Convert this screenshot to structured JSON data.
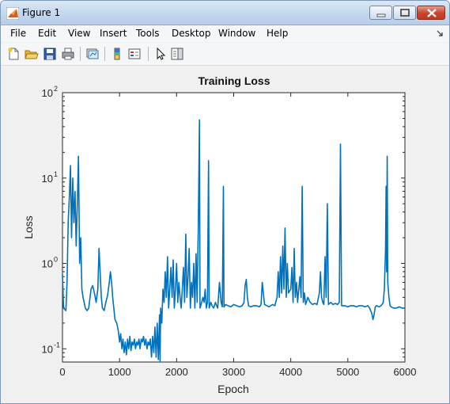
{
  "window": {
    "title": "Figure 1"
  },
  "menu": {
    "items": [
      "File",
      "Edit",
      "View",
      "Insert",
      "Tools",
      "Desktop",
      "Window",
      "Help"
    ]
  },
  "toolbar": {
    "icons": [
      "new-figure-icon",
      "open-file-icon",
      "save-icon",
      "print-icon",
      "link-plot-icon",
      "colorbar-icon",
      "legend-icon",
      "pointer-icon",
      "property-editor-icon"
    ]
  },
  "chart_data": {
    "type": "line",
    "title": "Training Loss",
    "xlabel": "Epoch",
    "ylabel": "Loss",
    "xlim": [
      0,
      6000
    ],
    "ylim": [
      0.07,
      100
    ],
    "yscale": "log",
    "x_ticks": [
      "0",
      "1000",
      "2000",
      "3000",
      "4000",
      "5000",
      "6000"
    ],
    "y_ticks": [
      "10",
      "10",
      "10",
      "10"
    ],
    "y_tick_exponents": [
      "-1",
      "0",
      "1",
      "2"
    ],
    "grid": false,
    "series": [
      {
        "color": "#0072bd",
        "points": [
          [
            0,
            0.75
          ],
          [
            20,
            0.3
          ],
          [
            60,
            0.28
          ],
          [
            80,
            0.6
          ],
          [
            100,
            3
          ],
          [
            120,
            6
          ],
          [
            140,
            14
          ],
          [
            160,
            2
          ],
          [
            180,
            10
          ],
          [
            200,
            3
          ],
          [
            220,
            7
          ],
          [
            240,
            1.6
          ],
          [
            260,
            5
          ],
          [
            280,
            18
          ],
          [
            300,
            1
          ],
          [
            320,
            2
          ],
          [
            340,
            0.5
          ],
          [
            360,
            0.4
          ],
          [
            380,
            0.35
          ],
          [
            400,
            0.3
          ],
          [
            430,
            0.28
          ],
          [
            460,
            0.3
          ],
          [
            500,
            0.5
          ],
          [
            530,
            0.55
          ],
          [
            560,
            0.45
          ],
          [
            590,
            0.35
          ],
          [
            620,
            0.5
          ],
          [
            640,
            1.5
          ],
          [
            660,
            0.8
          ],
          [
            680,
            0.4
          ],
          [
            700,
            0.3
          ],
          [
            730,
            0.28
          ],
          [
            760,
            0.35
          ],
          [
            790,
            0.42
          ],
          [
            820,
            0.6
          ],
          [
            840,
            0.8
          ],
          [
            860,
            0.6
          ],
          [
            880,
            0.4
          ],
          [
            900,
            0.3
          ],
          [
            920,
            0.22
          ],
          [
            950,
            0.2
          ],
          [
            980,
            0.16
          ],
          [
            1000,
            0.12
          ],
          [
            1020,
            0.15
          ],
          [
            1040,
            0.1
          ],
          [
            1060,
            0.13
          ],
          [
            1080,
            0.09
          ],
          [
            1100,
            0.12
          ],
          [
            1120,
            0.085
          ],
          [
            1140,
            0.13
          ],
          [
            1160,
            0.1
          ],
          [
            1180,
            0.14
          ],
          [
            1200,
            0.095
          ],
          [
            1220,
            0.12
          ],
          [
            1240,
            0.11
          ],
          [
            1260,
            0.13
          ],
          [
            1280,
            0.1
          ],
          [
            1300,
            0.12
          ],
          [
            1320,
            0.11
          ],
          [
            1340,
            0.13
          ],
          [
            1360,
            0.1
          ],
          [
            1380,
            0.13
          ],
          [
            1400,
            0.12
          ],
          [
            1420,
            0.14
          ],
          [
            1440,
            0.11
          ],
          [
            1460,
            0.13
          ],
          [
            1480,
            0.1
          ],
          [
            1500,
            0.12
          ],
          [
            1520,
            0.11
          ],
          [
            1540,
            0.13
          ],
          [
            1560,
            0.08
          ],
          [
            1580,
            0.14
          ],
          [
            1600,
            0.09
          ],
          [
            1620,
            0.18
          ],
          [
            1640,
            0.08
          ],
          [
            1660,
            0.2
          ],
          [
            1680,
            0.075
          ],
          [
            1700,
            0.25
          ],
          [
            1710,
            0.07
          ],
          [
            1720,
            0.3
          ],
          [
            1740,
            0.2
          ],
          [
            1760,
            0.5
          ],
          [
            1780,
            0.35
          ],
          [
            1800,
            0.8
          ],
          [
            1820,
            0.4
          ],
          [
            1840,
            1.2
          ],
          [
            1860,
            0.3
          ],
          [
            1880,
            0.5
          ],
          [
            1900,
            0.9
          ],
          [
            1920,
            0.4
          ],
          [
            1940,
            1.1
          ],
          [
            1960,
            0.3
          ],
          [
            1980,
            0.5
          ],
          [
            2000,
            1
          ],
          [
            2020,
            0.35
          ],
          [
            2040,
            0.6
          ],
          [
            2060,
            0.4
          ],
          [
            2080,
            0.3
          ],
          [
            2100,
            0.5
          ],
          [
            2120,
            0.9
          ],
          [
            2140,
            0.35
          ],
          [
            2160,
            2.2
          ],
          [
            2180,
            0.4
          ],
          [
            2200,
            0.7
          ],
          [
            2220,
            1.5
          ],
          [
            2240,
            0.3
          ],
          [
            2260,
            0.6
          ],
          [
            2280,
            0.4
          ],
          [
            2300,
            1
          ],
          [
            2320,
            0.3
          ],
          [
            2340,
            1.3
          ],
          [
            2360,
            0.35
          ],
          [
            2380,
            3
          ],
          [
            2400,
            48
          ],
          [
            2410,
            0.3
          ],
          [
            2440,
            0.35
          ],
          [
            2460,
            0.4
          ],
          [
            2480,
            0.35
          ],
          [
            2500,
            0.5
          ],
          [
            2520,
            0.3
          ],
          [
            2540,
            0.35
          ],
          [
            2560,
            16
          ],
          [
            2570,
            0.3
          ],
          [
            2600,
            0.35
          ],
          [
            2620,
            0.32
          ],
          [
            2650,
            0.3
          ],
          [
            2680,
            0.35
          ],
          [
            2700,
            0.32
          ],
          [
            2720,
            0.3
          ],
          [
            2750,
            0.6
          ],
          [
            2780,
            0.35
          ],
          [
            2800,
            0.31
          ],
          [
            2820,
            8
          ],
          [
            2830,
            0.31
          ],
          [
            2860,
            0.33
          ],
          [
            2900,
            0.32
          ],
          [
            2950,
            0.31
          ],
          [
            3000,
            0.33
          ],
          [
            3050,
            0.32
          ],
          [
            3100,
            0.31
          ],
          [
            3150,
            0.32
          ],
          [
            3180,
            0.35
          ],
          [
            3200,
            0.55
          ],
          [
            3220,
            0.65
          ],
          [
            3240,
            0.4
          ],
          [
            3260,
            0.32
          ],
          [
            3300,
            0.31
          ],
          [
            3350,
            0.32
          ],
          [
            3400,
            0.32
          ],
          [
            3450,
            0.31
          ],
          [
            3480,
            0.33
          ],
          [
            3500,
            0.6
          ],
          [
            3520,
            0.45
          ],
          [
            3540,
            0.33
          ],
          [
            3580,
            0.32
          ],
          [
            3620,
            0.31
          ],
          [
            3680,
            0.33
          ],
          [
            3720,
            0.32
          ],
          [
            3760,
            0.4
          ],
          [
            3780,
            0.8
          ],
          [
            3800,
            0.4
          ],
          [
            3820,
            1.2
          ],
          [
            3840,
            0.45
          ],
          [
            3860,
            1.6
          ],
          [
            3880,
            0.5
          ],
          [
            3900,
            2.6
          ],
          [
            3920,
            0.4
          ],
          [
            3940,
            1
          ],
          [
            3960,
            0.45
          ],
          [
            4000,
            0.5
          ],
          [
            4020,
            0.9
          ],
          [
            4040,
            0.35
          ],
          [
            4060,
            1.5
          ],
          [
            4080,
            0.4
          ],
          [
            4100,
            0.6
          ],
          [
            4120,
            0.35
          ],
          [
            4140,
            0.5
          ],
          [
            4160,
            0.7
          ],
          [
            4180,
            0.4
          ],
          [
            4200,
            8
          ],
          [
            4220,
            0.35
          ],
          [
            4240,
            0.45
          ],
          [
            4260,
            0.33
          ],
          [
            4300,
            0.4
          ],
          [
            4340,
            0.35
          ],
          [
            4380,
            0.33
          ],
          [
            4420,
            0.34
          ],
          [
            4460,
            0.33
          ],
          [
            4500,
            0.45
          ],
          [
            4520,
            0.8
          ],
          [
            4540,
            0.4
          ],
          [
            4560,
            0.35
          ],
          [
            4580,
            0.33
          ],
          [
            4600,
            1.2
          ],
          [
            4620,
            0.4
          ],
          [
            4640,
            5
          ],
          [
            4660,
            0.33
          ],
          [
            4700,
            0.35
          ],
          [
            4740,
            0.33
          ],
          [
            4780,
            0.34
          ],
          [
            4820,
            0.33
          ],
          [
            4850,
            0.35
          ],
          [
            4870,
            25
          ],
          [
            4890,
            0.32
          ],
          [
            4950,
            0.32
          ],
          [
            5000,
            0.31
          ],
          [
            5050,
            0.32
          ],
          [
            5100,
            0.32
          ],
          [
            5150,
            0.31
          ],
          [
            5200,
            0.32
          ],
          [
            5250,
            0.32
          ],
          [
            5300,
            0.31
          ],
          [
            5350,
            0.32
          ],
          [
            5380,
            0.3
          ],
          [
            5420,
            0.26
          ],
          [
            5440,
            0.22
          ],
          [
            5460,
            0.25
          ],
          [
            5480,
            0.31
          ],
          [
            5500,
            0.32
          ],
          [
            5550,
            0.31
          ],
          [
            5580,
            0.32
          ],
          [
            5600,
            0.33
          ],
          [
            5620,
            0.35
          ],
          [
            5640,
            0.5
          ],
          [
            5660,
            1.5
          ],
          [
            5670,
            8
          ],
          [
            5680,
            0.8
          ],
          [
            5690,
            18
          ],
          [
            5700,
            0.6
          ],
          [
            5720,
            0.4
          ],
          [
            5740,
            0.32
          ],
          [
            5760,
            0.31
          ],
          [
            5800,
            0.3
          ],
          [
            5850,
            0.3
          ],
          [
            5900,
            0.31
          ],
          [
            5950,
            0.3
          ],
          [
            6000,
            0.3
          ]
        ]
      }
    ]
  }
}
